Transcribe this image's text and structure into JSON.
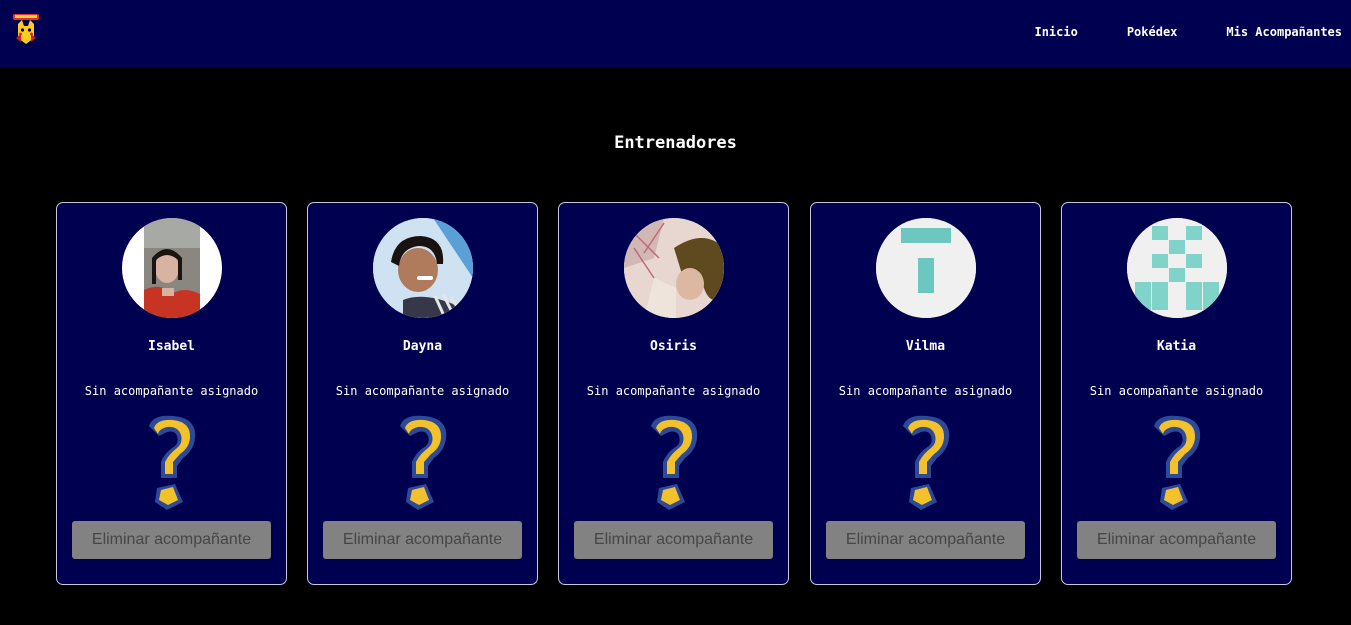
{
  "app": {
    "logo_icon": "pokedex-pikachu-logo-icon",
    "brand_color": "#000050",
    "background_color": "#000000"
  },
  "nav": {
    "links": [
      {
        "label": "Inicio"
      },
      {
        "label": "Pokédex"
      },
      {
        "label": "Mis Acompañantes"
      }
    ]
  },
  "main": {
    "title": "Entrenadores"
  },
  "trainers": [
    {
      "name": "Isabel",
      "status": "Sin acompañante asignado",
      "avatar_icon": "photo-avatar-icon",
      "button_label": "Eliminar acompañante"
    },
    {
      "name": "Dayna",
      "status": "Sin acompañante asignado",
      "avatar_icon": "photo-avatar-icon",
      "button_label": "Eliminar acompañante"
    },
    {
      "name": "Osiris",
      "status": "Sin acompañante asignado",
      "avatar_icon": "photo-avatar-icon",
      "button_label": "Eliminar acompañante"
    },
    {
      "name": "Vilma",
      "status": "Sin acompañante asignado",
      "avatar_icon": "identicon-avatar-icon",
      "button_label": "Eliminar acompañante"
    },
    {
      "name": "Katia",
      "status": "Sin acompañante asignado",
      "avatar_icon": "identicon-avatar-icon",
      "button_label": "Eliminar acompañante"
    }
  ],
  "companion_placeholder_icon": "question-mark-icon"
}
